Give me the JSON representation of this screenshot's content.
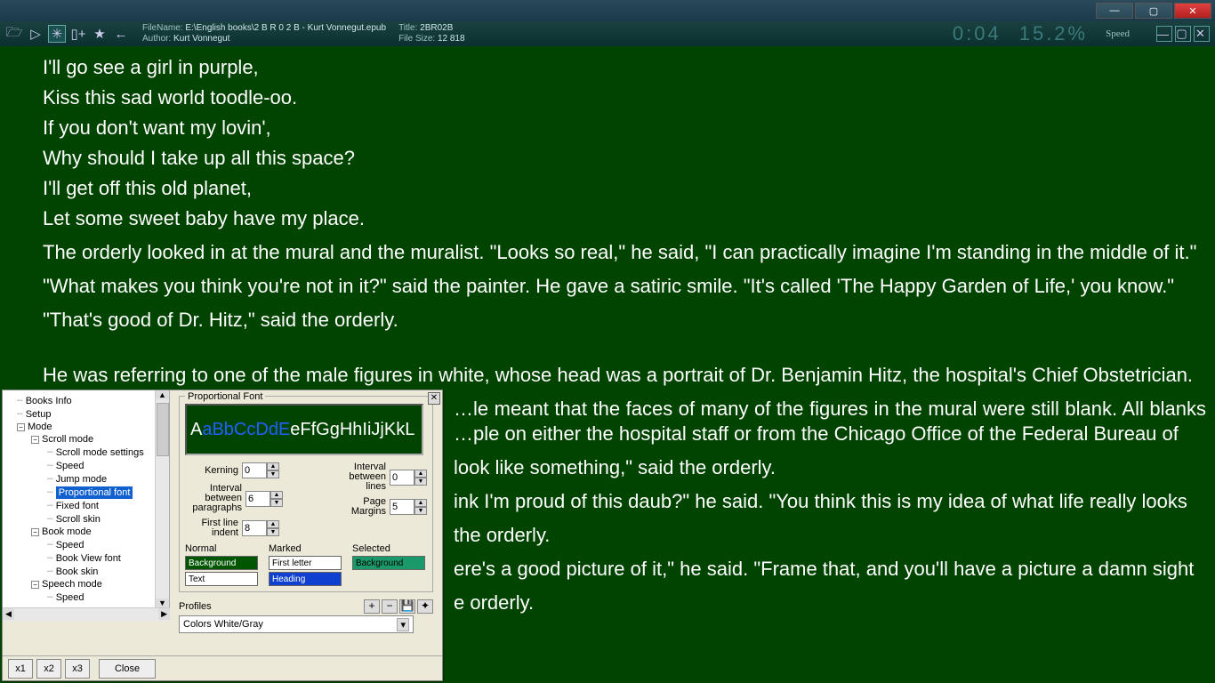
{
  "window": {
    "min": "—",
    "max": "▢",
    "close": "✕"
  },
  "toolbar": {
    "file_label": "FileName:",
    "file_value": "E:\\English books\\2 B R 0 2 B - Kurt Vonnegut.epub",
    "author_label": "Author:",
    "author_value": "Kurt Vonnegut",
    "title_label": "Title:",
    "title_value": "2BR02B",
    "size_label": "File Size:",
    "size_value": "12 818",
    "time": "0:04",
    "percent": "15.2%",
    "speed_label": "Speed"
  },
  "reader": {
    "lines": [
      "I'll go see a girl in purple,",
      "Kiss this sad world toodle-oo.",
      "If you don't want my lovin',",
      "Why should I take up all this space?",
      "I'll get off this old planet,",
      "Let some sweet baby have my place."
    ],
    "p1": "The orderly looked in at the mural and the muralist. \"Looks so real,\" he said, \"I can practically imagine I'm standing in the middle of it.\"",
    "p2": "\"What makes you think you're not in it?\" said the painter. He gave a satiric smile. \"It's called 'The Happy Garden of Life,' you know.\"",
    "p3": "\"That's good of Dr. Hitz,\" said the orderly.",
    "p4": "He was referring to one of the male figures in white, whose head was a portrait of Dr. Benjamin Hitz, the hospital's Chief Obstetrician.",
    "p5": "…le meant that the faces of many of the figures in the mural were still blank. All blanks …ple on either the hospital staff or from the Chicago Office of the Federal Bureau of",
    "p6": "look like something,\" said the orderly.",
    "p7": "ink I'm proud of this daub?\" he said. \"You think this is my idea of what life really looks",
    "p8": "the orderly.",
    "p9": "ere's a good picture of it,\" he said. \"Frame that, and you'll have a picture a damn sight",
    "p10": "e orderly."
  },
  "dialog": {
    "tree": {
      "books_info": "Books Info",
      "setup": "Setup",
      "mode": "Mode",
      "scroll_mode": "Scroll mode",
      "scroll_settings": "Scroll mode settings",
      "speed": "Speed",
      "jump_mode": "Jump mode",
      "prop_font": "Proportional font",
      "fixed_font": "Fixed font",
      "scroll_skin": "Scroll skin",
      "book_mode": "Book mode",
      "bv_font": "Book View font",
      "book_skin": "Book skin",
      "speech_mode": "Speech mode"
    },
    "panel": {
      "legend": "Proportional Font",
      "preview_white1": "A",
      "preview_blue": "aBbCcDdE",
      "preview_white2": "eFfGgHhIiJjKkL",
      "kerning_label": "Kerning",
      "kerning_val": "0",
      "ibp_label": "Interval between paragraphs",
      "ibp_val": "6",
      "fli_label": "First line indent",
      "fli_val": "8",
      "ibl_label": "Interval between lines",
      "ibl_val": "0",
      "pm_label": "Page Margins",
      "pm_val": "5",
      "normal": "Normal",
      "marked": "Marked",
      "selected": "Selected",
      "bg": "Background",
      "text": "Text",
      "first_letter": "First letter",
      "heading": "Heading",
      "profiles": "Profiles",
      "profile_value": "Colors White/Gray",
      "plus": "+",
      "minus": "−",
      "save": "💾",
      "gear": "✦"
    },
    "footer": {
      "x1": "x1",
      "x2": "x2",
      "x3": "x3",
      "close": "Close"
    }
  }
}
